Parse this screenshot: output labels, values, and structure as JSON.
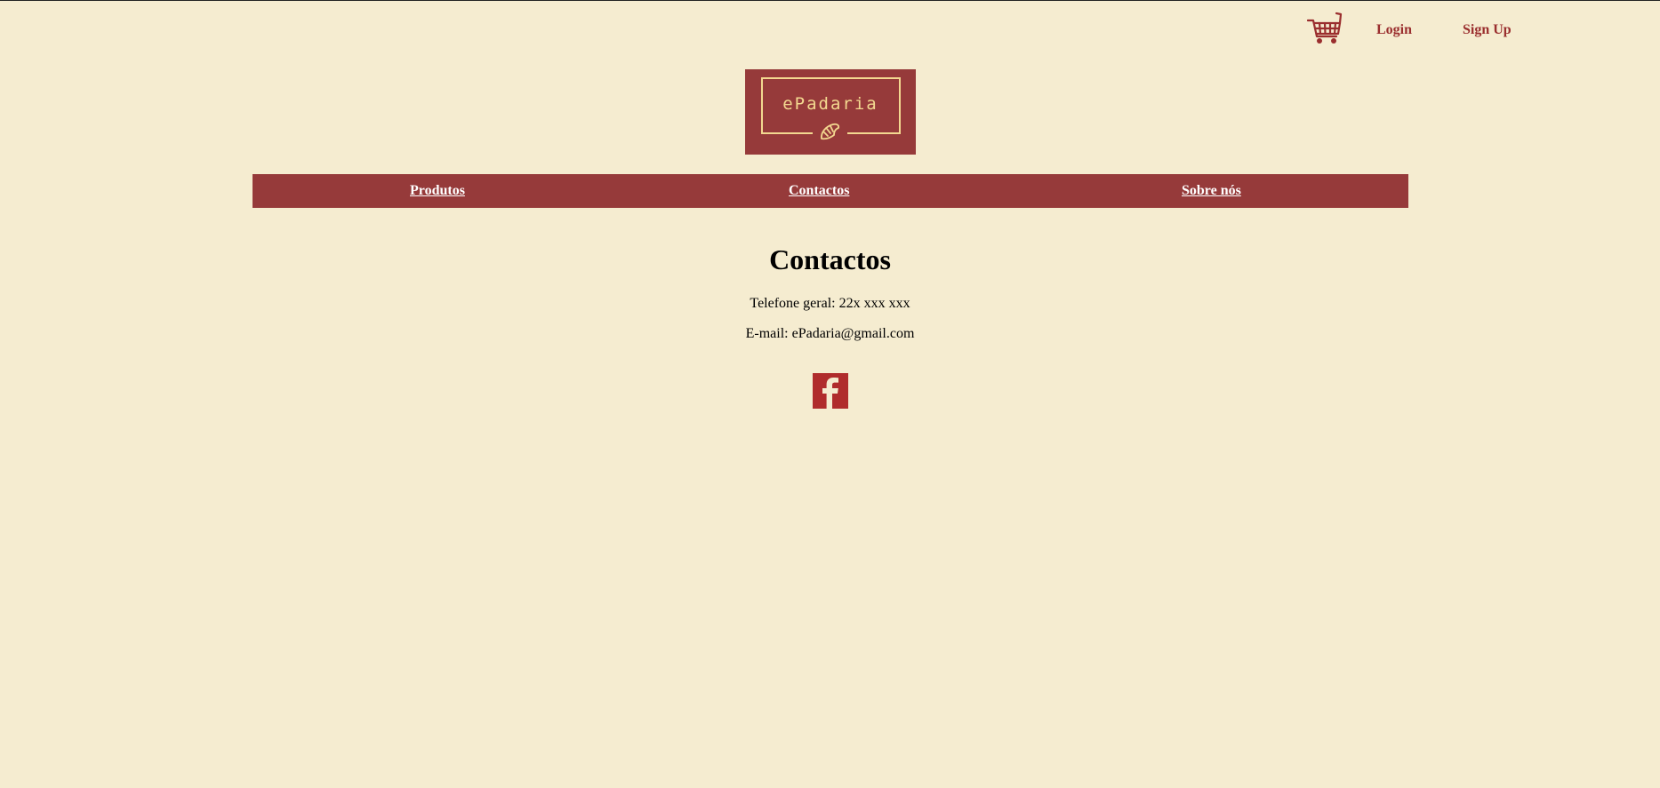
{
  "header": {
    "cart_icon": "shopping-cart-icon",
    "login_label": "Login",
    "signup_label": "Sign Up"
  },
  "logo": {
    "text": "ePadaria",
    "icon": "croissant-icon"
  },
  "nav": {
    "items": [
      {
        "label": "Produtos"
      },
      {
        "label": "Contactos"
      },
      {
        "label": "Sobre nós"
      }
    ]
  },
  "main": {
    "title": "Contactos",
    "phone": "Telefone geral: 22x xxx xxx",
    "email": "E-mail: ePadaria@gmail.com",
    "social_icon": "facebook-icon"
  },
  "colors": {
    "background": "#f5ecd0",
    "brand": "#963a3a",
    "accent_text": "#9a2e2e",
    "logo_gold": "#f3d890",
    "facebook_box": "#b02c2c"
  }
}
